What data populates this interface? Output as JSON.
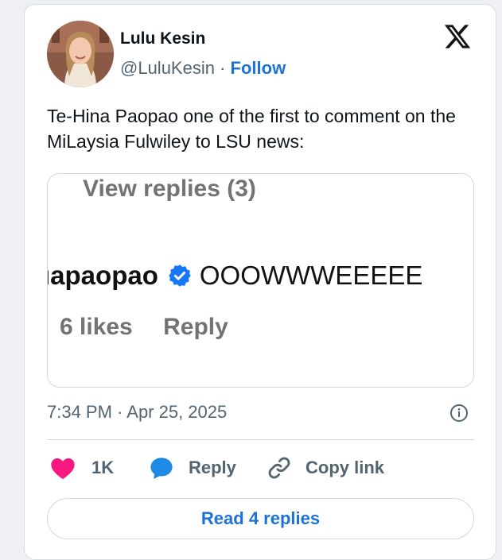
{
  "author": {
    "name": "Lulu Kesin",
    "handle": "@LuluKesin",
    "separator": "·",
    "follow_label": "Follow"
  },
  "tweet": {
    "text": "Te-Hina Paopao one of the first to comment on the MiLaysia Fulwiley to LSU news:",
    "timestamp": "7:34 PM · Apr 25, 2025"
  },
  "embedded_comment": {
    "view_replies": "View replies (3)",
    "username": "ıapaopao",
    "comment": "OOOWWWEEEEE",
    "likes": "6 likes",
    "reply_label": "Reply"
  },
  "actions": {
    "like_count": "1K",
    "reply_label": "Reply",
    "copy_link_label": "Copy link"
  },
  "read_replies_label": "Read 4 replies",
  "colors": {
    "like_pink": "#f91880",
    "reply_blue": "#1d8ae6",
    "link_blue": "#1d72d6",
    "verified_blue": "#1877f2"
  },
  "icons": [
    "x-logo-icon",
    "info-icon",
    "heart-icon",
    "reply-bubble-icon",
    "link-icon",
    "verified-badge-icon"
  ]
}
